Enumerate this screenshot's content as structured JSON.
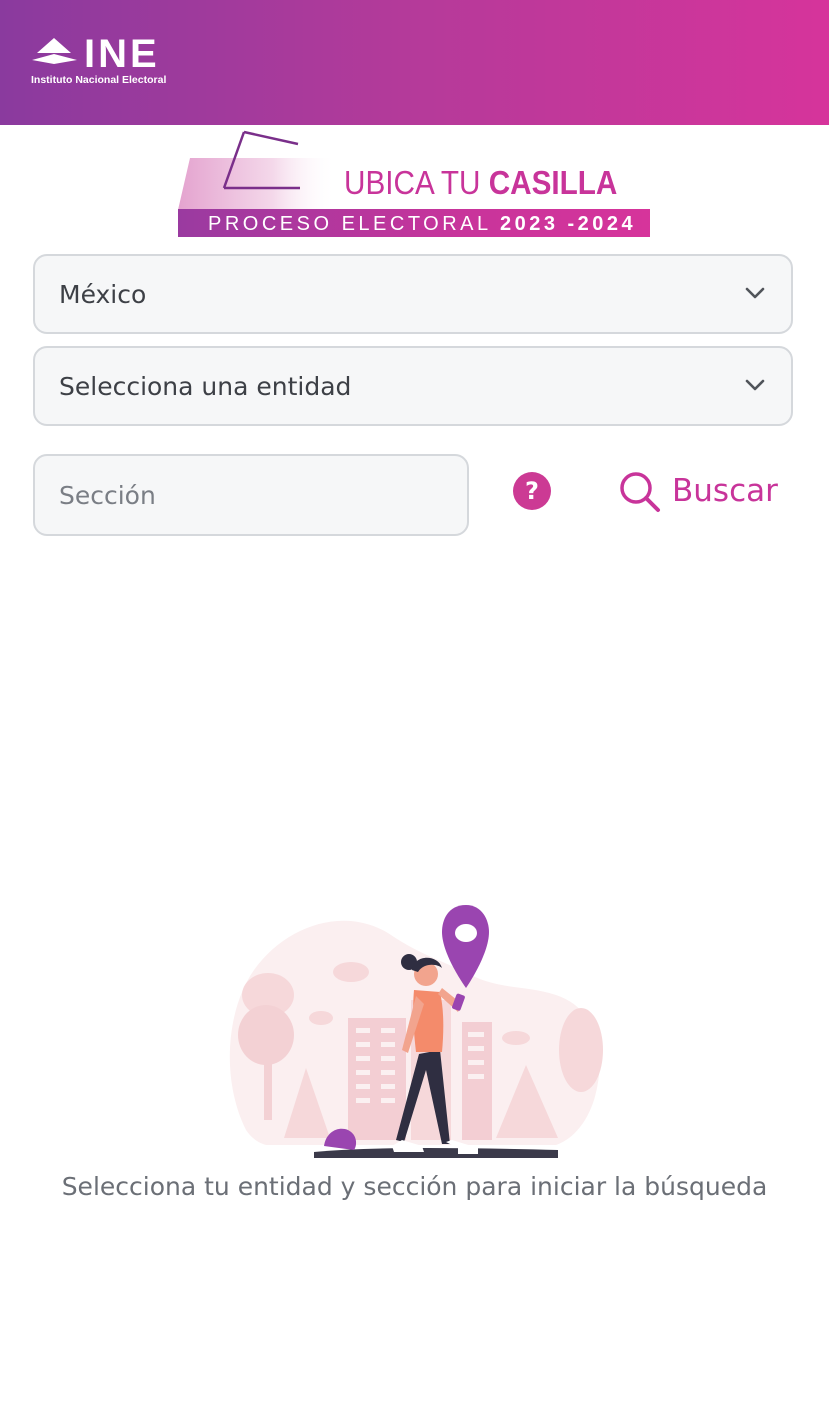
{
  "header": {
    "logo": {
      "name": "INE",
      "subtitle": "Instituto Nacional Electoral"
    },
    "gradient": [
      "#8a3a9e",
      "#d6349b"
    ]
  },
  "banner": {
    "title_light": "UBICA TU",
    "title_bold": "CASILLA",
    "subtitle_light": "PROCESO ELECTORAL",
    "subtitle_bold": "2023 -2024"
  },
  "form": {
    "country_select": {
      "value": "México",
      "icon": "chevron-down-icon"
    },
    "entity_select": {
      "value": "Selecciona una entidad",
      "icon": "chevron-down-icon"
    },
    "section_input": {
      "value": "",
      "placeholder": "Sección"
    },
    "help_button": {
      "label": "?",
      "icon": "help-icon"
    },
    "search_button": {
      "label": "Buscar",
      "icon": "search-icon"
    }
  },
  "empty_state": {
    "message": "Selecciona tu entidad y sección para iniciar la búsqueda",
    "illustration": "woman-with-phone-location-pin"
  },
  "colors": {
    "accent": "#c8349a",
    "field_border": "#d5d8dc",
    "field_bg": "#f6f7f8",
    "pin": "#9a45b0"
  }
}
